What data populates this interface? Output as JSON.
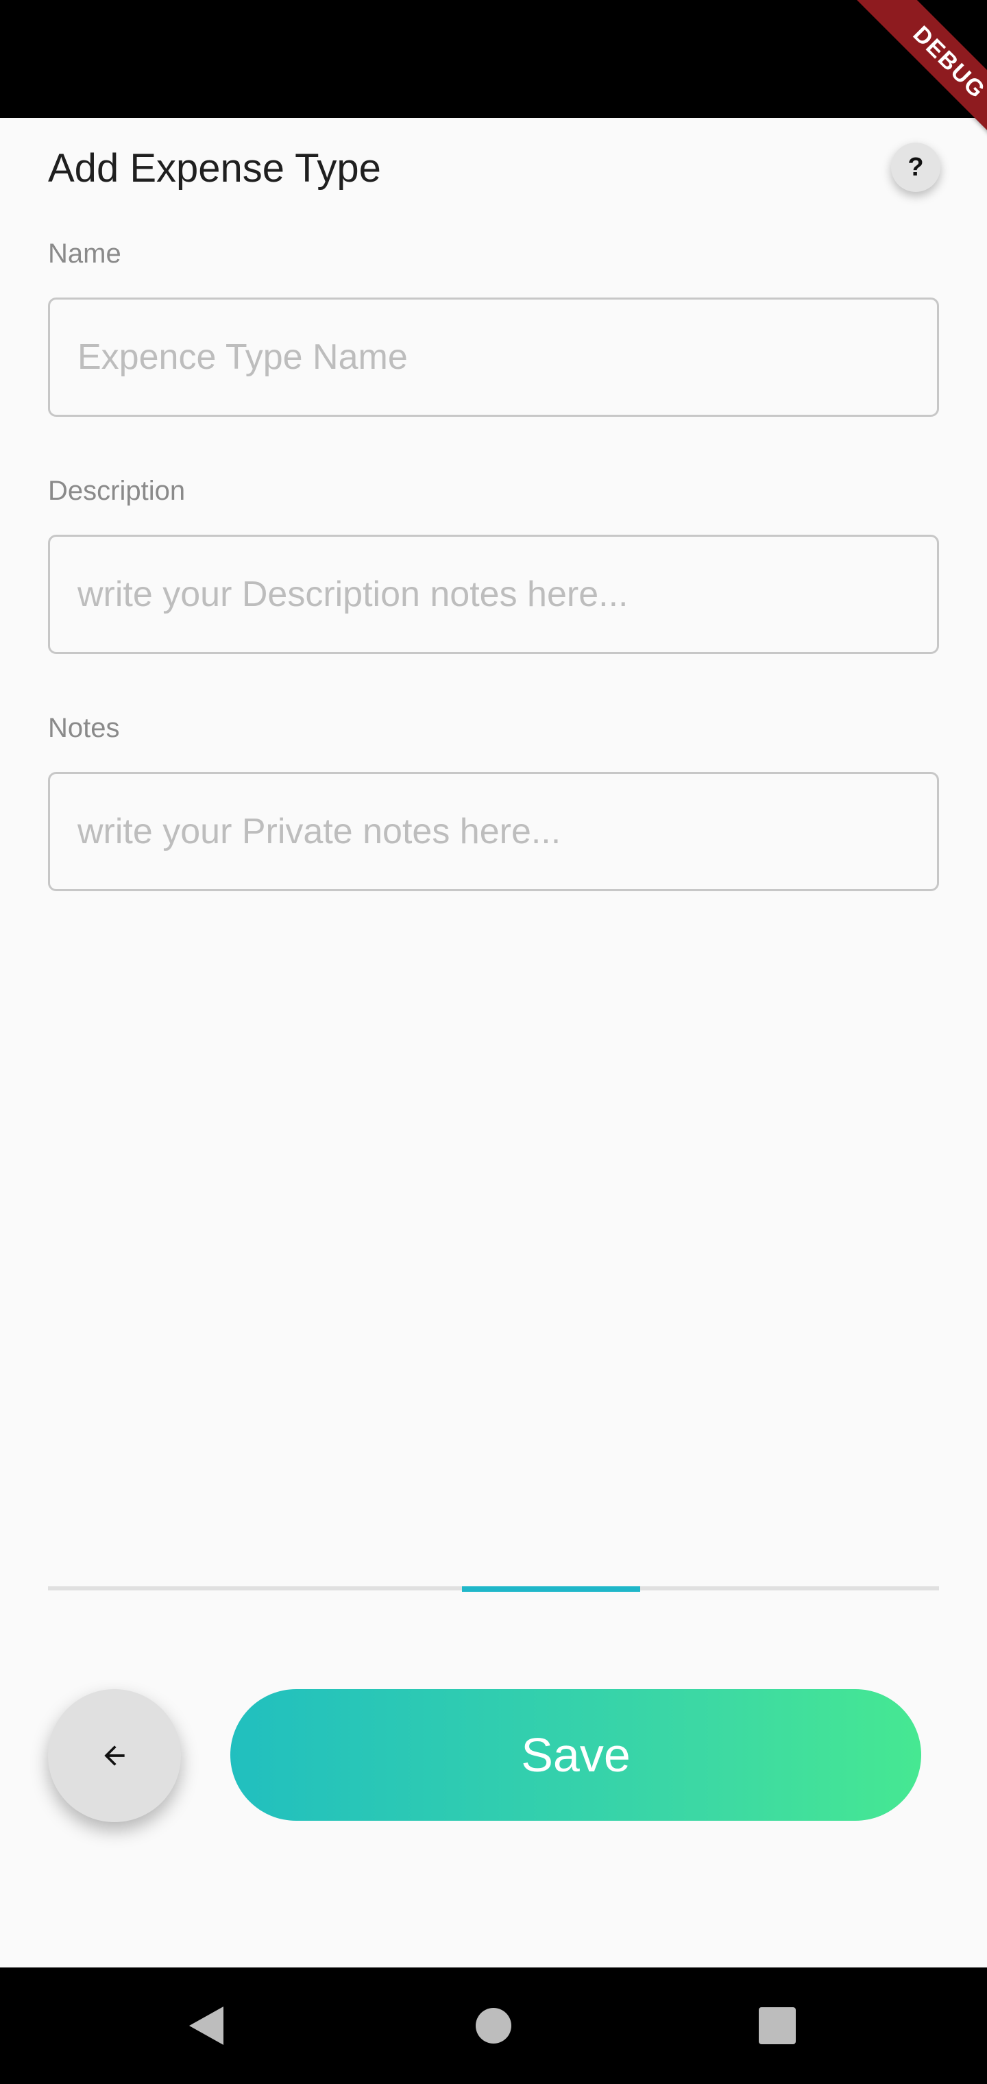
{
  "status_bar": {
    "debug_label": "DEBUG"
  },
  "header": {
    "title": "Add Expense Type",
    "help_label": "?"
  },
  "form": {
    "name": {
      "label": "Name",
      "value": "",
      "placeholder": "Expence Type Name"
    },
    "description": {
      "label": "Description",
      "value": "",
      "placeholder": "write your Description notes here..."
    },
    "notes": {
      "label": "Notes",
      "value": "",
      "placeholder": "write your Private notes here..."
    }
  },
  "progress": {
    "segments": 7,
    "active_segment_start": 4,
    "active_segment_end": 5,
    "track_color": "#e0e0e0",
    "active_color": "#1fb7c9"
  },
  "actions": {
    "back_icon": "arrow-left-icon",
    "save_label": "Save",
    "save_gradient": [
      "#21bfbf",
      "#46e892"
    ]
  },
  "nav_bar": {
    "icons": [
      "nav-back-icon",
      "nav-home-icon",
      "nav-recents-icon"
    ]
  }
}
